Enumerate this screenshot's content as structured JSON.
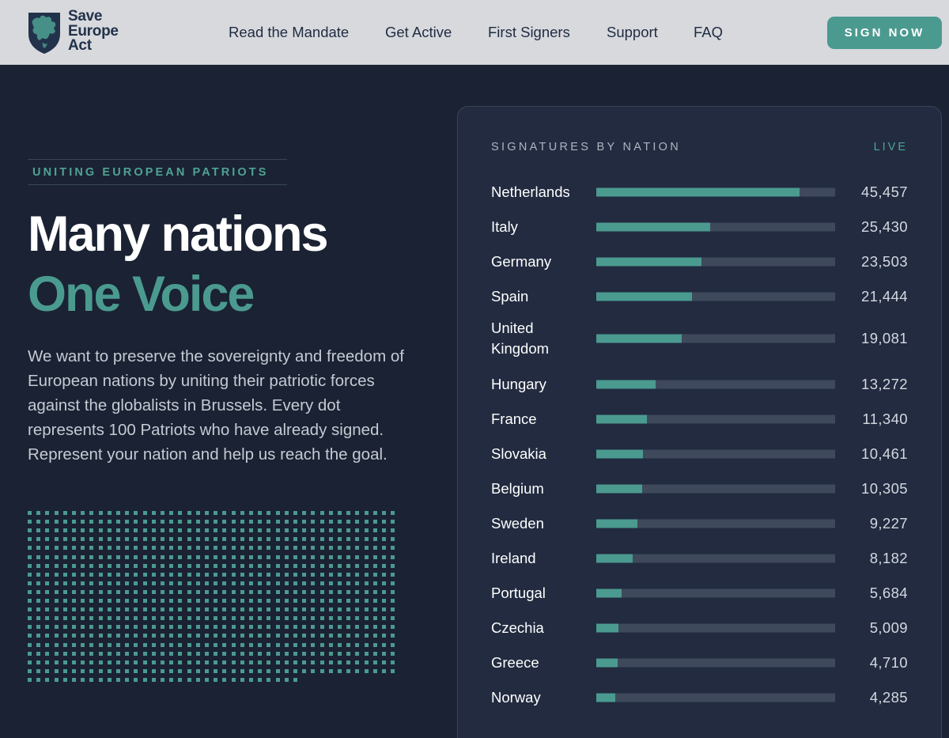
{
  "header": {
    "logo_lines": [
      "Save",
      "Europe",
      "Act"
    ],
    "nav": [
      {
        "label": "Read the Mandate",
        "name": "nav-read-the-mandate"
      },
      {
        "label": "Get Active",
        "name": "nav-get-active"
      },
      {
        "label": "First Signers",
        "name": "nav-first-signers"
      },
      {
        "label": "Support",
        "name": "nav-support"
      },
      {
        "label": "FAQ",
        "name": "nav-faq"
      }
    ],
    "cta_label": "SIGN NOW"
  },
  "hero": {
    "tagline": "UNITING EUROPEAN PATRIOTS",
    "title": "Many nations",
    "title_accent": "One Voice",
    "description": "We want to preserve the sovereignty and freedom of European nations by uniting their patriotic forces against the globalists in Brussels. Every dot represents 100 Patriots who have already signed. Represent your nation and help us reach the goal."
  },
  "panel": {
    "title": "SIGNATURES BY NATION",
    "status": "LIVE",
    "bar_max": 53500,
    "rows": [
      {
        "country": "Netherlands",
        "value": 45457,
        "display": "45,457"
      },
      {
        "country": "Italy",
        "value": 25430,
        "display": "25,430"
      },
      {
        "country": "Germany",
        "value": 23503,
        "display": "23,503"
      },
      {
        "country": "Spain",
        "value": 21444,
        "display": "21,444"
      },
      {
        "country": "United Kingdom",
        "value": 19081,
        "display": "19,081"
      },
      {
        "country": "Hungary",
        "value": 13272,
        "display": "13,272"
      },
      {
        "country": "France",
        "value": 11340,
        "display": "11,340"
      },
      {
        "country": "Slovakia",
        "value": 10461,
        "display": "10,461"
      },
      {
        "country": "Belgium",
        "value": 10305,
        "display": "10,305"
      },
      {
        "country": "Sweden",
        "value": 9227,
        "display": "9,227"
      },
      {
        "country": "Ireland",
        "value": 8182,
        "display": "8,182"
      },
      {
        "country": "Portugal",
        "value": 5684,
        "display": "5,684"
      },
      {
        "country": "Czechia",
        "value": 5009,
        "display": "5,009"
      },
      {
        "country": "Greece",
        "value": 4710,
        "display": "4,710"
      },
      {
        "country": "Norway",
        "value": 4285,
        "display": "4,285"
      }
    ]
  },
  "colors": {
    "accent": "#4b9a8f",
    "background": "#1a2233",
    "panel": "#222b40",
    "header": "#d7d9dd",
    "navy_text": "#22324a"
  },
  "icons": {
    "logo": "europe-shield-icon"
  }
}
